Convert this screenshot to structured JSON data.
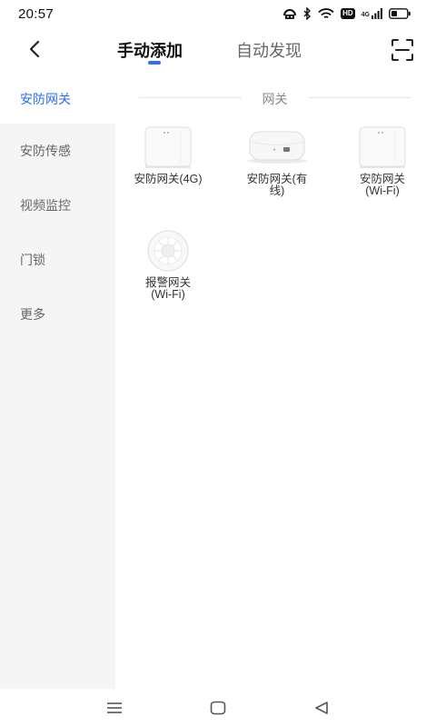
{
  "status_bar": {
    "time": "20:57",
    "hd_label": "HD",
    "network_label": "4G",
    "icons": [
      "nfc-icon",
      "bluetooth-icon",
      "wifi-icon",
      "hd-icon",
      "signal-icon",
      "battery-icon"
    ]
  },
  "header": {
    "back_icon": "back-icon",
    "tabs": [
      {
        "label": "手动添加",
        "active": true
      },
      {
        "label": "自动发现",
        "active": false
      }
    ],
    "scan_icon": "scan-icon"
  },
  "sidebar": {
    "items": [
      {
        "label": "安防网关",
        "active": true
      },
      {
        "label": "安防传感",
        "active": false
      },
      {
        "label": "视频监控",
        "active": false
      },
      {
        "label": "门锁",
        "active": false
      },
      {
        "label": "更多",
        "active": false
      }
    ]
  },
  "main": {
    "section_title": "网关",
    "devices": [
      {
        "name": "安防网关(4G)",
        "icon": "gateway-box-icon"
      },
      {
        "name": "安防网关(有\n线)",
        "icon": "wired-gateway-icon"
      },
      {
        "name": "安防网关\n(Wi-Fi)",
        "icon": "gateway-box-icon"
      },
      {
        "name": "报警网关\n(Wi-Fi)",
        "icon": "alarm-gateway-icon"
      }
    ]
  },
  "nav_bar": {
    "icons": [
      "menu-icon",
      "home-icon",
      "back-triangle-icon"
    ]
  },
  "colors": {
    "accent": "#2a6ef5",
    "sidebar_bg": "#f5f5f5",
    "text_muted": "#666666"
  }
}
